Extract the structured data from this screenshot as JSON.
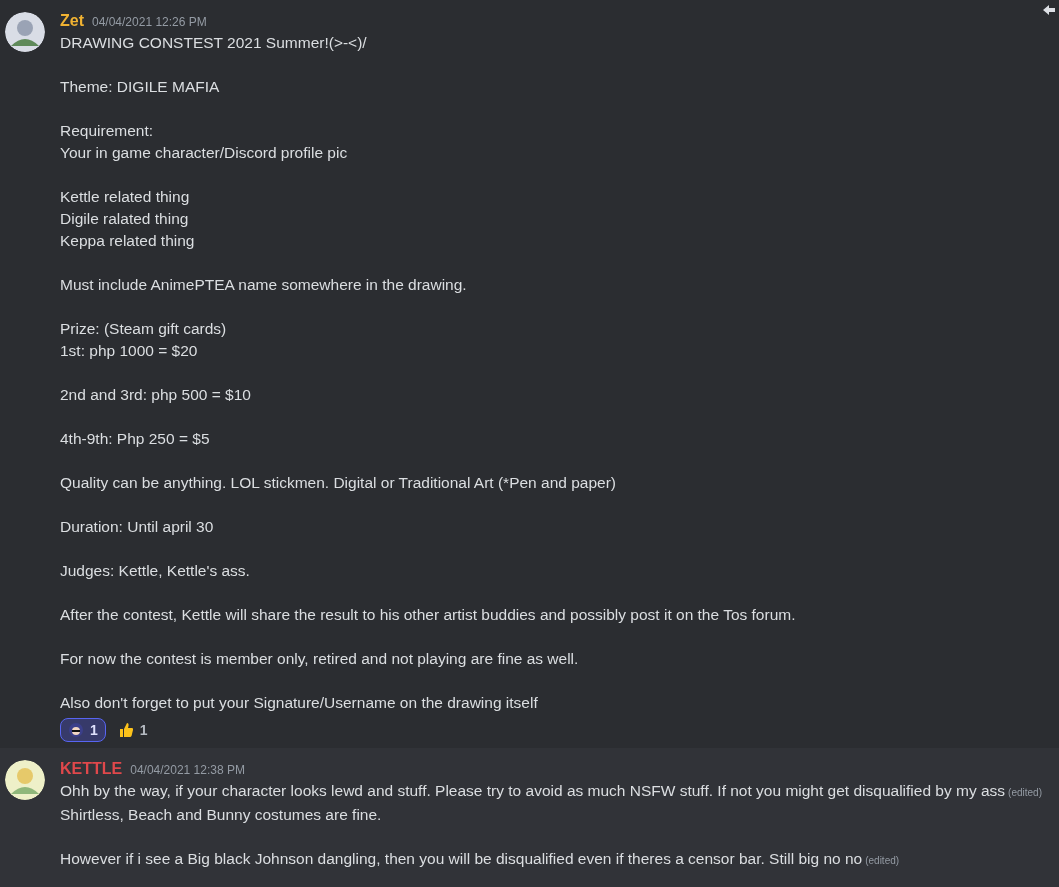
{
  "messages": [
    {
      "author": "Zet",
      "color": "#f0b232",
      "timestamp": "04/04/2021 12:26 PM",
      "highlighted": true,
      "paragraphs": [
        [
          {
            "text": "DRAWING CONSTEST 2021 Summer!(>-<)/"
          }
        ],
        [
          {
            "text": "Theme: DIGILE MAFIA"
          }
        ],
        [
          {
            "text": "Requirement:"
          },
          {
            "text": "Your in game character/Discord profile pic"
          }
        ],
        [
          {
            "text": "Kettle related thing"
          },
          {
            "text": "Digile ralated thing"
          },
          {
            "text": "Keppa related thing"
          }
        ],
        [
          {
            "text": "Must include AnimePTEA name somewhere in the drawing."
          }
        ],
        [
          {
            "text": "Prize: (Steam gift cards)"
          },
          {
            "text": "1st: php 1000 = $20"
          }
        ],
        [
          {
            "text": "2nd and 3rd: php 500 = $10"
          }
        ],
        [
          {
            "text": "4th-9th: Php 250 = $5"
          }
        ],
        [
          {
            "text": "Quality can be anything. LOL stickmen. Digital or Traditional Art (*Pen and paper)"
          }
        ],
        [
          {
            "text": "Duration: Until april 30"
          }
        ],
        [
          {
            "text": "Judges: Kettle, Kettle's ass."
          }
        ],
        [
          {
            "text": "After the contest, Kettle will share the result to his other artist buddies and possibly post it on the Tos forum."
          }
        ],
        [
          {
            "text": "For now the contest is member only, retired and not playing are fine as well."
          }
        ],
        [
          {
            "text": "Also don't forget to put your Signature/Username on the drawing itself"
          }
        ]
      ],
      "reactions": [
        {
          "kind": "avatar",
          "count": "1",
          "selected": true
        },
        {
          "kind": "thumbs",
          "count": "1",
          "selected": false
        }
      ]
    },
    {
      "author": "KETTLE",
      "color": "#e0484b",
      "timestamp": "04/04/2021 12:38 PM",
      "highlighted": false,
      "paragraphs": [
        [
          {
            "text": "Ohh by the way, if your character looks lewd and stuff. Please try to avoid as much NSFW stuff. If not you might get disqualified by my ass",
            "edited": "(edited)"
          },
          {
            "text": "Shirtless, Beach and Bunny costumes are fine."
          }
        ],
        [
          {
            "text": "However if i see a Big black Johnson dangling, then you will be disqualified even if theres a censor bar. Still big no no",
            "edited": "(edited)"
          }
        ]
      ]
    }
  ]
}
